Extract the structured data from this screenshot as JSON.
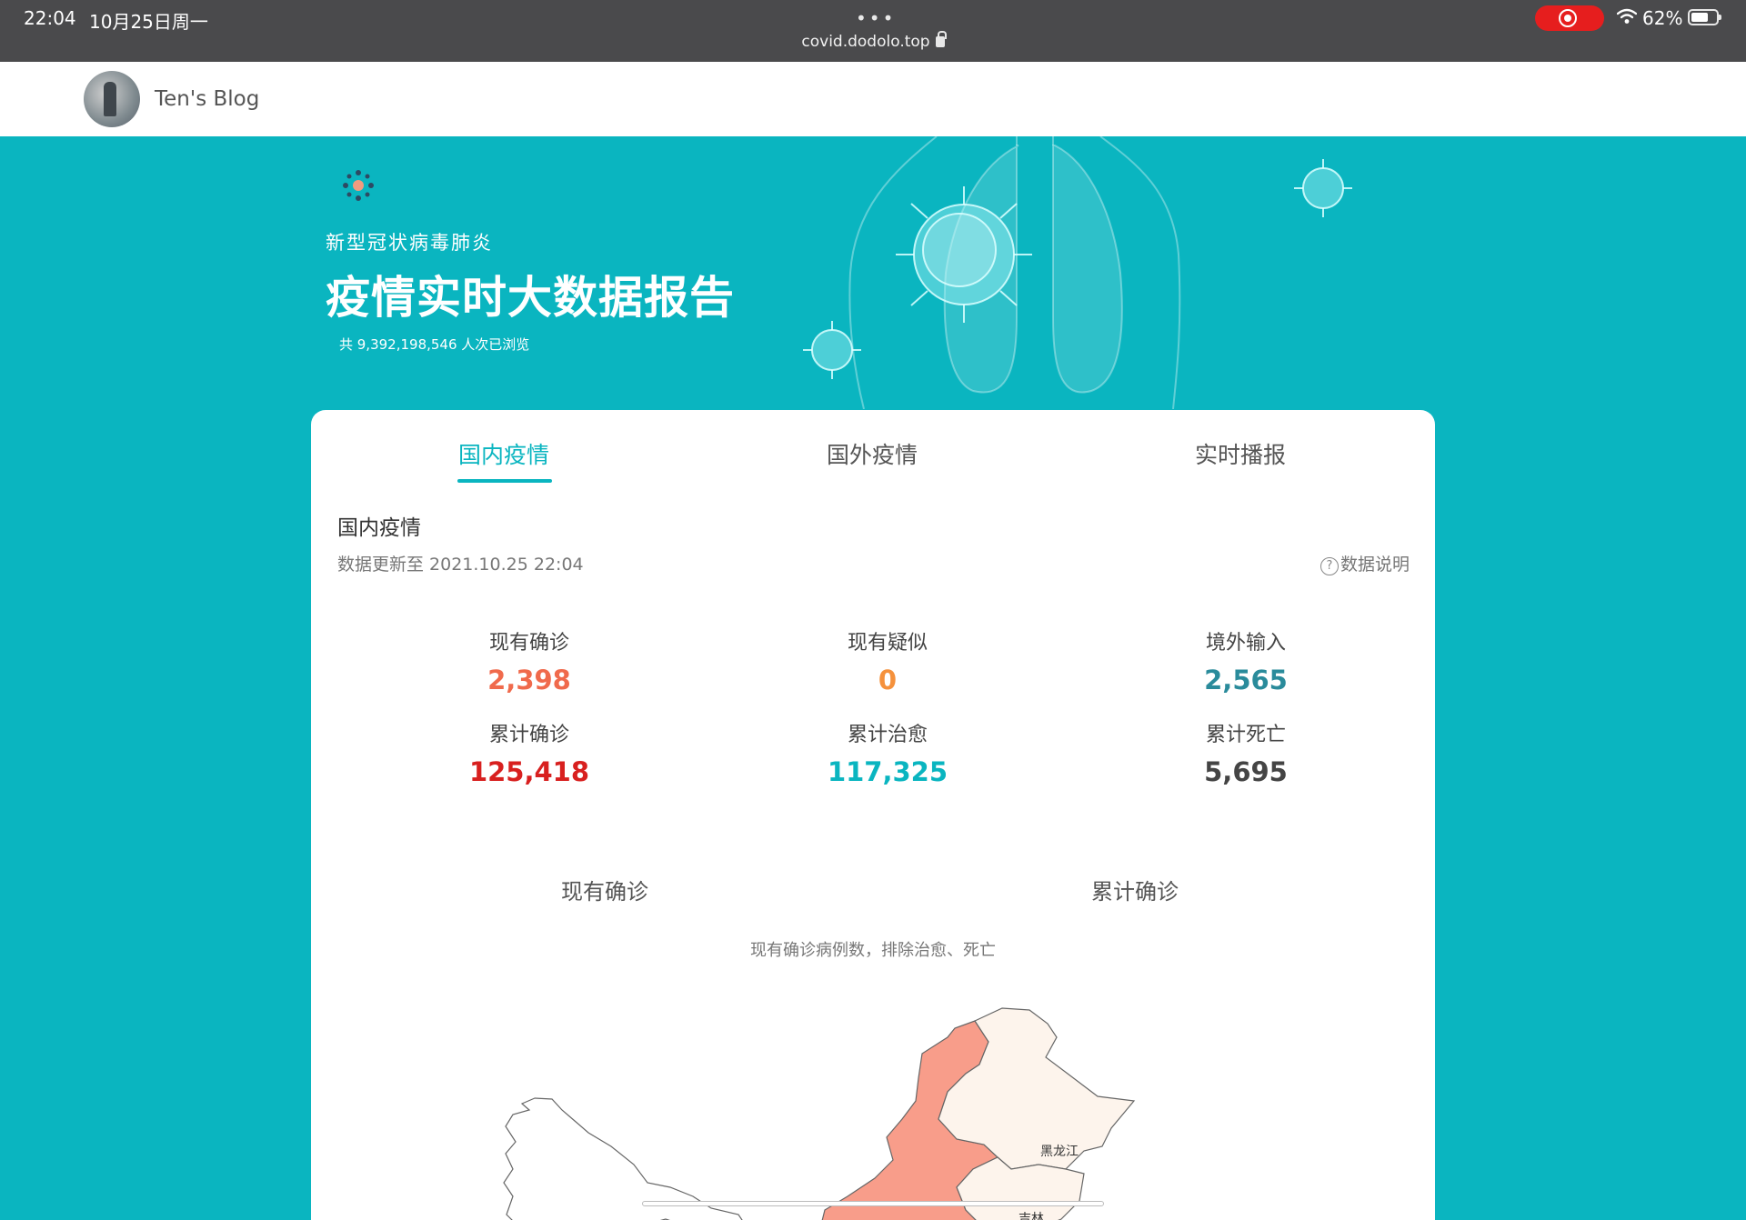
{
  "statusbar": {
    "time": "22:04",
    "date": "10月25日周一",
    "dots": "•••",
    "url": "covid.dodolo.top",
    "battery": "62%"
  },
  "blog": {
    "title": "Ten's Blog"
  },
  "hero": {
    "subtitle": "新型冠状病毒肺炎",
    "title": "疫情实时大数据报告",
    "views": "共 9,392,198,546 人次已浏览"
  },
  "tabs": [
    {
      "label": "国内疫情",
      "active": true
    },
    {
      "label": "国外疫情",
      "active": false
    },
    {
      "label": "实时播报",
      "active": false
    }
  ],
  "section": {
    "title": "国内疫情",
    "update_time": "数据更新至 2021.10.25 22:04",
    "data_note": "数据说明"
  },
  "stats": [
    {
      "label": "现有确诊",
      "value": "2,398",
      "color": "#f06a4c"
    },
    {
      "label": "现有疑似",
      "value": "0",
      "color": "#f5913c"
    },
    {
      "label": "境外输入",
      "value": "2,565",
      "color": "#2a8b9b"
    },
    {
      "label": "累计确诊",
      "value": "125,418",
      "color": "#d8201f"
    },
    {
      "label": "累计治愈",
      "value": "117,325",
      "color": "#0ab5c0"
    },
    {
      "label": "累计死亡",
      "value": "5,695",
      "color": "#444444"
    }
  ],
  "map": {
    "tab_current": "现有确诊",
    "tab_total": "累计确诊",
    "caption": "现有确诊病例数，排除治愈、死亡",
    "label_heilongjiang": "黑龙江",
    "label_jilin": "吉林"
  },
  "colors": {
    "accent": "#0ab5c0",
    "map_high": "#f89d8a",
    "map_low": "#fdf4ec"
  }
}
